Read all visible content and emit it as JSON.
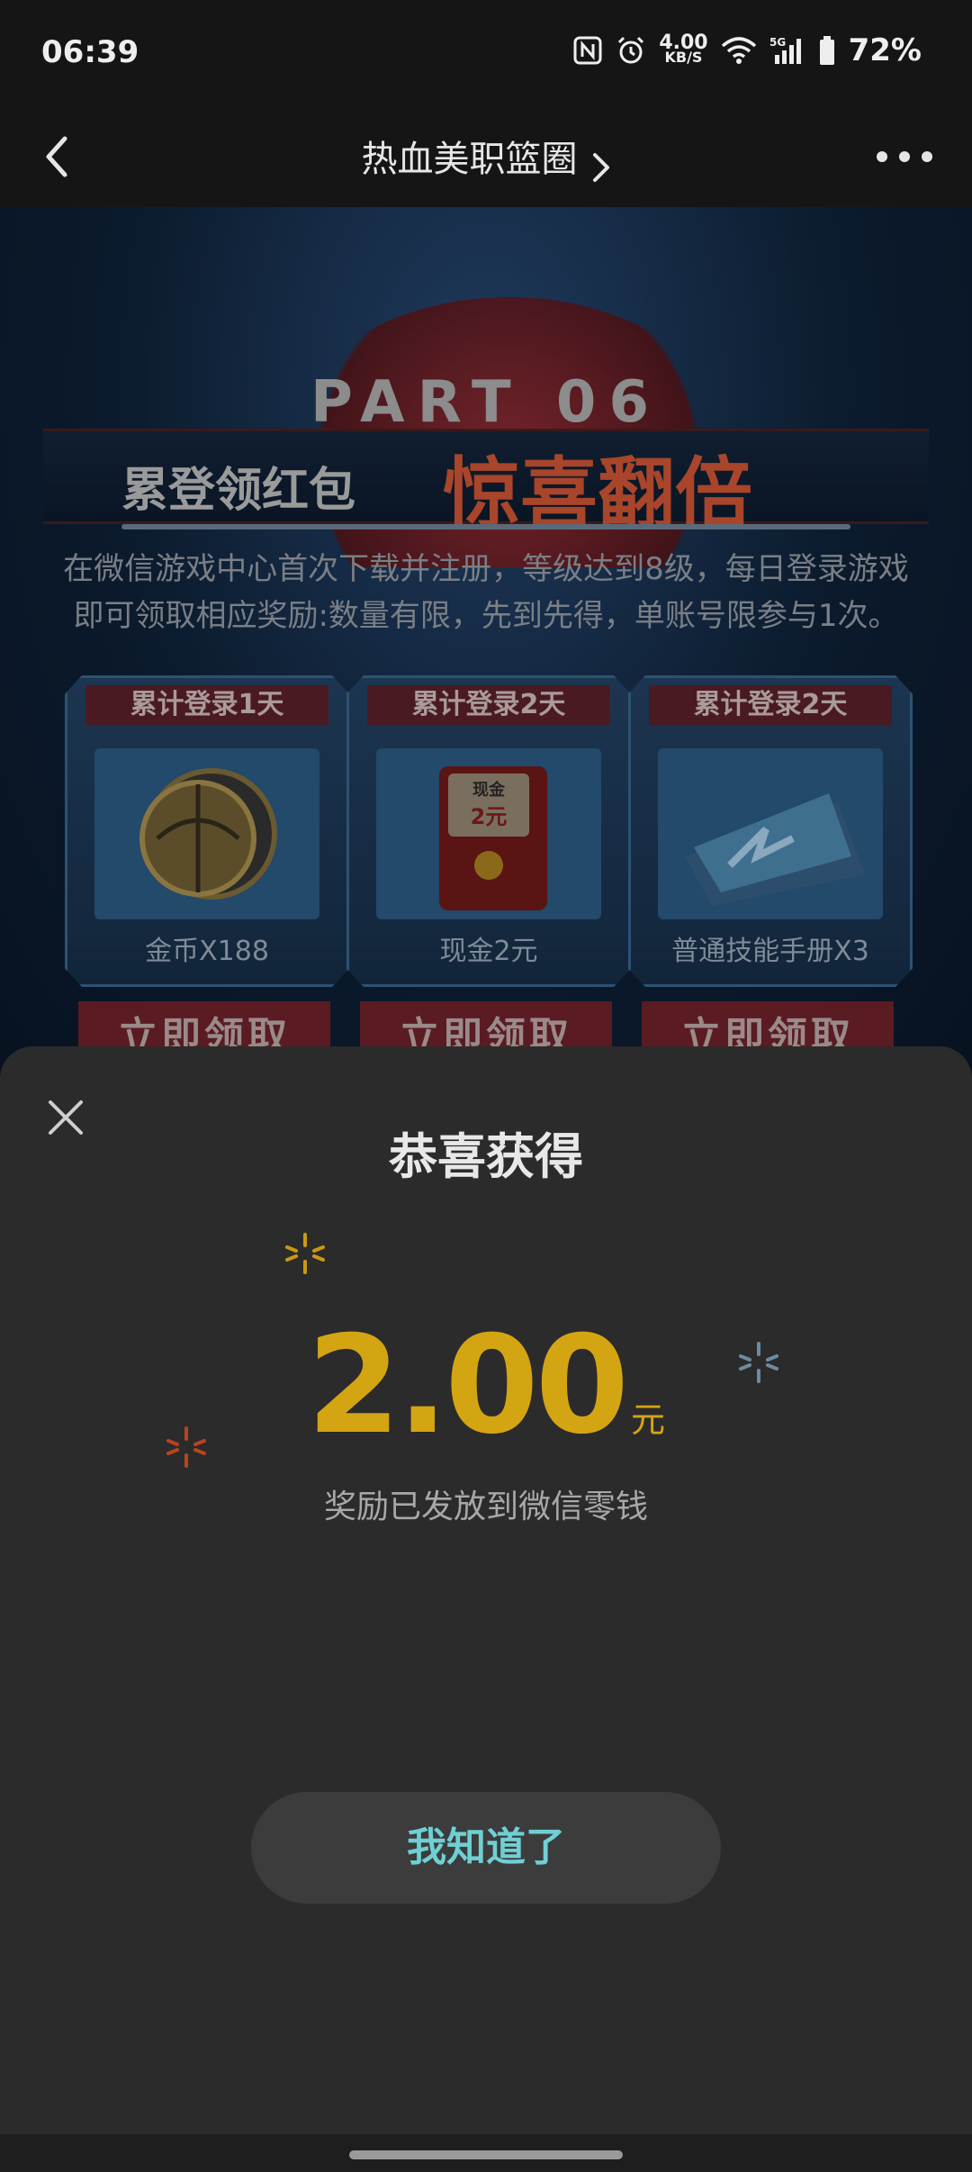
{
  "status_bar": {
    "time": "06:39",
    "net_speed_value": "4.00",
    "net_speed_unit": "KB/S",
    "battery": "72%",
    "icons": [
      "nfc-icon",
      "alarm-icon",
      "wifi-icon",
      "signal-5g-icon",
      "battery-icon"
    ]
  },
  "header": {
    "title": "热血美职篮圈",
    "back_icon": "chevron-left-icon",
    "more_icon": "more-dots-icon"
  },
  "background": {
    "part_label": "PART 06",
    "banner_small": "累登领红包",
    "banner_big": "惊喜翻倍",
    "description": "在微信游戏中心首次下载并注册，等级达到8级，每日登录游戏即可领取相应奖励:数量有限，先到先得，单账号限参与1次。",
    "cards": [
      {
        "head": "累计登录1天",
        "name": "金币X188",
        "claim": "立即领取"
      },
      {
        "head": "累计登录2天",
        "name": "现金2元",
        "claim": "立即领取"
      },
      {
        "head": "累计登录2天",
        "name": "普通技能手册X3",
        "claim": "立即领取"
      }
    ],
    "card2_tag": "现金",
    "card2_amount": "2元"
  },
  "dialog": {
    "title": "恭喜获得",
    "amount": "2.00",
    "unit": "元",
    "note": "奖励已发放到微信零钱",
    "ok_label": "我知道了",
    "accent_color": "#d4a512",
    "button_text_color": "#6fd0d4"
  }
}
